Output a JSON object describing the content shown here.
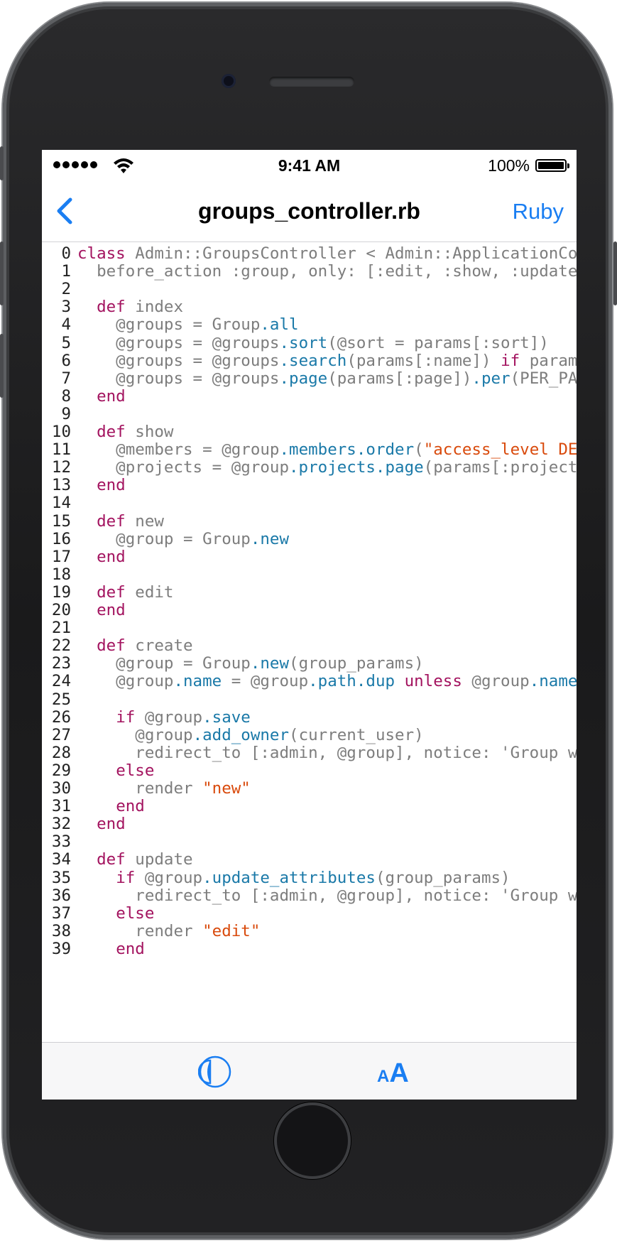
{
  "status_bar": {
    "time": "9:41 AM",
    "battery": "100%",
    "signal_icon": "signal-dots-icon",
    "wifi_icon": "wifi-icon",
    "battery_icon": "battery-icon"
  },
  "nav": {
    "back_icon": "chevron-left-icon",
    "title": "groups_controller.rb",
    "language_button": "Ruby"
  },
  "toolbar": {
    "theme_icon": "contrast-icon",
    "font_size_small": "A",
    "font_size_big": "A"
  },
  "colors": {
    "accent": "#1a7ef2",
    "keyword": "#a3135f",
    "method": "#1a79a8",
    "string": "#d94a0c",
    "text": "#7d7d7d"
  },
  "code": [
    {
      "n": "0",
      "t": [
        [
          "kw",
          "class"
        ],
        [
          "t",
          " Admin::GroupsController < Admin::ApplicationController"
        ]
      ]
    },
    {
      "n": "1",
      "t": [
        [
          "t",
          "  before_action :group, only: [:edit, :show, :update, :destroy, :project_update, :members_update]"
        ]
      ]
    },
    {
      "n": "2",
      "t": []
    },
    {
      "n": "3",
      "t": [
        [
          "t",
          "  "
        ],
        [
          "kw",
          "def"
        ],
        [
          "t",
          " index"
        ]
      ]
    },
    {
      "n": "4",
      "t": [
        [
          "t",
          "    @groups = Group"
        ],
        [
          "fn",
          ".all"
        ]
      ]
    },
    {
      "n": "5",
      "t": [
        [
          "t",
          "    @groups = @groups"
        ],
        [
          "fn",
          ".sort"
        ],
        [
          "t",
          "(@sort = params[:sort])"
        ]
      ]
    },
    {
      "n": "6",
      "t": [
        [
          "t",
          "    @groups = @groups"
        ],
        [
          "fn",
          ".search"
        ],
        [
          "t",
          "(params[:name]) "
        ],
        [
          "kw",
          "if"
        ],
        [
          "t",
          " params[:name].present?"
        ]
      ]
    },
    {
      "n": "7",
      "t": [
        [
          "t",
          "    @groups = @groups"
        ],
        [
          "fn",
          ".page"
        ],
        [
          "t",
          "(params[:page])"
        ],
        [
          "fn",
          ".per"
        ],
        [
          "t",
          "(PER_PAGE)"
        ]
      ]
    },
    {
      "n": "8",
      "t": [
        [
          "t",
          "  "
        ],
        [
          "kw",
          "end"
        ]
      ]
    },
    {
      "n": "9",
      "t": []
    },
    {
      "n": "10",
      "t": [
        [
          "t",
          "  "
        ],
        [
          "kw",
          "def"
        ],
        [
          "t",
          " show"
        ]
      ]
    },
    {
      "n": "11",
      "t": [
        [
          "t",
          "    @members = @group"
        ],
        [
          "fn",
          ".members.order"
        ],
        [
          "t",
          "("
        ],
        [
          "str",
          "\"access_level DESC\""
        ],
        [
          "t",
          ")"
        ]
      ]
    },
    {
      "n": "12",
      "t": [
        [
          "t",
          "    @projects = @group"
        ],
        [
          "fn",
          ".projects.page"
        ],
        [
          "t",
          "(params[:projects_page])"
        ]
      ]
    },
    {
      "n": "13",
      "t": [
        [
          "t",
          "  "
        ],
        [
          "kw",
          "end"
        ]
      ]
    },
    {
      "n": "14",
      "t": []
    },
    {
      "n": "15",
      "t": [
        [
          "t",
          "  "
        ],
        [
          "kw",
          "def"
        ],
        [
          "t",
          " new"
        ]
      ]
    },
    {
      "n": "16",
      "t": [
        [
          "t",
          "    @group = Group"
        ],
        [
          "fn",
          ".new"
        ]
      ]
    },
    {
      "n": "17",
      "t": [
        [
          "t",
          "  "
        ],
        [
          "kw",
          "end"
        ]
      ]
    },
    {
      "n": "18",
      "t": []
    },
    {
      "n": "19",
      "t": [
        [
          "t",
          "  "
        ],
        [
          "kw",
          "def"
        ],
        [
          "t",
          " edit"
        ]
      ]
    },
    {
      "n": "20",
      "t": [
        [
          "t",
          "  "
        ],
        [
          "kw",
          "end"
        ]
      ]
    },
    {
      "n": "21",
      "t": []
    },
    {
      "n": "22",
      "t": [
        [
          "t",
          "  "
        ],
        [
          "kw",
          "def"
        ],
        [
          "t",
          " create"
        ]
      ]
    },
    {
      "n": "23",
      "t": [
        [
          "t",
          "    @group = Group"
        ],
        [
          "fn",
          ".new"
        ],
        [
          "t",
          "(group_params)"
        ]
      ]
    },
    {
      "n": "24",
      "t": [
        [
          "t",
          "    @group"
        ],
        [
          "fn",
          ".name"
        ],
        [
          "t",
          " = @group"
        ],
        [
          "fn",
          ".path.dup"
        ],
        [
          "t",
          " "
        ],
        [
          "kw",
          "unless"
        ],
        [
          "t",
          " @group"
        ],
        [
          "fn",
          ".name"
        ]
      ]
    },
    {
      "n": "25",
      "t": []
    },
    {
      "n": "26",
      "t": [
        [
          "t",
          "    "
        ],
        [
          "kw",
          "if"
        ],
        [
          "t",
          " @group"
        ],
        [
          "fn",
          ".save"
        ]
      ]
    },
    {
      "n": "27",
      "t": [
        [
          "t",
          "      @group"
        ],
        [
          "fn",
          ".add_owner"
        ],
        [
          "t",
          "(current_user)"
        ]
      ]
    },
    {
      "n": "28",
      "t": [
        [
          "t",
          "      redirect_to [:admin, @group], notice: 'Group was successfully created.'"
        ]
      ]
    },
    {
      "n": "29",
      "t": [
        [
          "t",
          "    "
        ],
        [
          "kw",
          "else"
        ]
      ]
    },
    {
      "n": "30",
      "t": [
        [
          "t",
          "      render "
        ],
        [
          "str",
          "\"new\""
        ]
      ]
    },
    {
      "n": "31",
      "t": [
        [
          "t",
          "    "
        ],
        [
          "kw",
          "end"
        ]
      ]
    },
    {
      "n": "32",
      "t": [
        [
          "t",
          "  "
        ],
        [
          "kw",
          "end"
        ]
      ]
    },
    {
      "n": "33",
      "t": []
    },
    {
      "n": "34",
      "t": [
        [
          "t",
          "  "
        ],
        [
          "kw",
          "def"
        ],
        [
          "t",
          " update"
        ]
      ]
    },
    {
      "n": "35",
      "t": [
        [
          "t",
          "    "
        ],
        [
          "kw",
          "if"
        ],
        [
          "t",
          " @group"
        ],
        [
          "fn",
          ".update_attributes"
        ],
        [
          "t",
          "(group_params)"
        ]
      ]
    },
    {
      "n": "36",
      "t": [
        [
          "t",
          "      redirect_to [:admin, @group], notice: 'Group was successfully updated.'"
        ]
      ]
    },
    {
      "n": "37",
      "t": [
        [
          "t",
          "    "
        ],
        [
          "kw",
          "else"
        ]
      ]
    },
    {
      "n": "38",
      "t": [
        [
          "t",
          "      render "
        ],
        [
          "str",
          "\"edit\""
        ]
      ]
    },
    {
      "n": "39",
      "t": [
        [
          "t",
          "    "
        ],
        [
          "kw",
          "end"
        ]
      ]
    }
  ]
}
